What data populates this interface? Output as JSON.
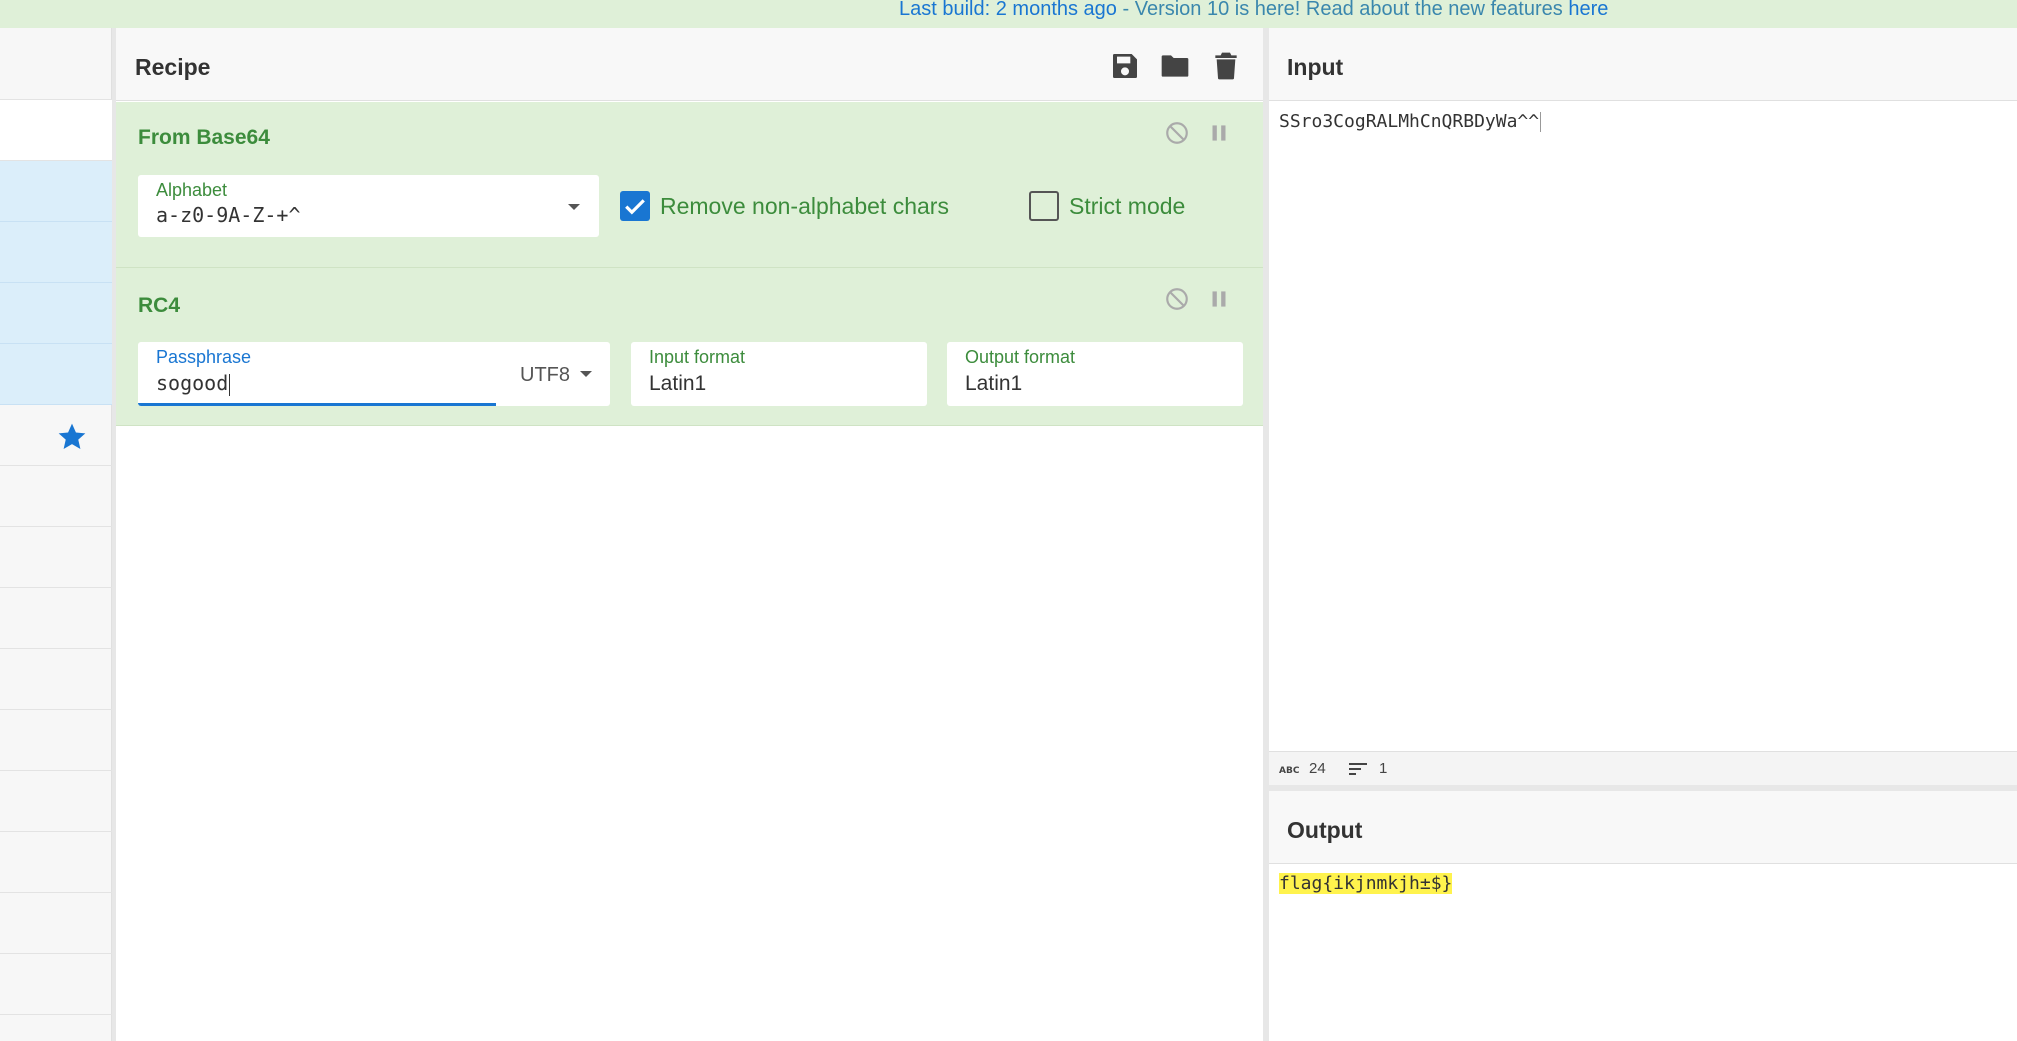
{
  "banner": {
    "build_text": "Last build: 2 months ago",
    "separator": " - ",
    "version_text": "Version 10 is here! Read about the new features ",
    "link_text": "here"
  },
  "recipe": {
    "title": "Recipe",
    "icons": [
      "save-icon",
      "folder-icon",
      "trash-icon"
    ],
    "operations": [
      {
        "title": "From Base64",
        "alphabet_label": "Alphabet",
        "alphabet_value": "a-z0-9A-Z-+^",
        "remove_nonalpha_label": "Remove non-alphabet chars",
        "remove_nonalpha_checked": true,
        "strict_mode_label": "Strict mode",
        "strict_mode_checked": false
      },
      {
        "title": "RC4",
        "passphrase_label": "Passphrase",
        "passphrase_value": "sogood",
        "passphrase_encoding": "UTF8",
        "input_format_label": "Input format",
        "input_format_value": "Latin1",
        "output_format_label": "Output format",
        "output_format_value": "Latin1"
      }
    ]
  },
  "input": {
    "title": "Input",
    "text": "SSro3CogRALMhCnQRBDyWa^^",
    "stats": {
      "length": "24",
      "lines": "1"
    }
  },
  "output": {
    "title": "Output",
    "text": "flag{ikjnmkjh±$}"
  },
  "colors": {
    "banner_bg": "#dff0d8",
    "op_bg": "#dff0d8",
    "op_title": "#3c8c3c",
    "accent": "#1976d2",
    "highlight": "#fff34d"
  }
}
